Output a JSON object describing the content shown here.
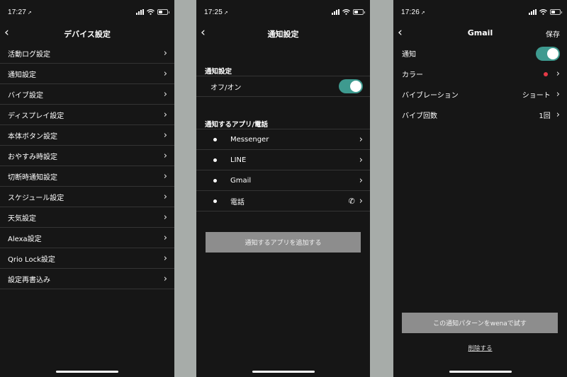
{
  "screen1": {
    "time": "17:27",
    "title": "デバイス設定",
    "items": [
      {
        "label": "活動ログ設定"
      },
      {
        "label": "通知設定"
      },
      {
        "label": "バイブ設定"
      },
      {
        "label": "ディスプレイ設定"
      },
      {
        "label": "本体ボタン設定"
      },
      {
        "label": "おやすみ時設定"
      },
      {
        "label": "切断時通知設定"
      },
      {
        "label": "スケジュール設定"
      },
      {
        "label": "天気設定"
      },
      {
        "label": "Alexa設定"
      },
      {
        "label": "Qrio Lock設定"
      },
      {
        "label": "設定再書込み"
      }
    ]
  },
  "screen2": {
    "time": "17:25",
    "title": "通知設定",
    "section1": "通知設定",
    "toggle_label": "オフ/オン",
    "toggle_on": true,
    "section2": "通知するアプリ/電話",
    "apps": [
      {
        "label": "Messenger"
      },
      {
        "label": "LINE"
      },
      {
        "label": "Gmail"
      },
      {
        "label": "電話"
      }
    ],
    "add_button": "通知するアプリを追加する"
  },
  "screen3": {
    "time": "17:26",
    "title": "Gmail",
    "save_label": "保存",
    "rows": {
      "notify": "通知",
      "color": "カラー",
      "color_value": "#e63946",
      "vibration": "バイブレーション",
      "vibration_value": "ショート",
      "count": "バイブ回数",
      "count_value": "1回"
    },
    "test_button": "この通知パターンをwenaで試す",
    "delete_label": "削除する"
  },
  "colors": {
    "background": "#161616",
    "divider": "#343434",
    "toggle_accent": "#3e9a8f",
    "button_gray": "#8d8d8d",
    "gutter": "#a7aca9"
  }
}
